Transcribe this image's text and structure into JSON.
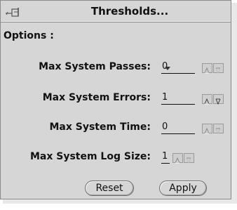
{
  "window": {
    "title": "Thresholds..."
  },
  "options_label": "Options :",
  "fields": [
    {
      "label": "Max System Passes:",
      "value": "0"
    },
    {
      "label": "Max System Errors:",
      "value": "1"
    },
    {
      "label": "Max System Time:",
      "value": "0"
    },
    {
      "label": "Max System Log Size:",
      "value": "1"
    }
  ],
  "buttons": {
    "reset": "Reset",
    "apply": "Apply"
  },
  "icons": {
    "pin": "pushpin-icon",
    "increment": "up-arrow-icon",
    "decrement": "down-arrow-icon"
  }
}
